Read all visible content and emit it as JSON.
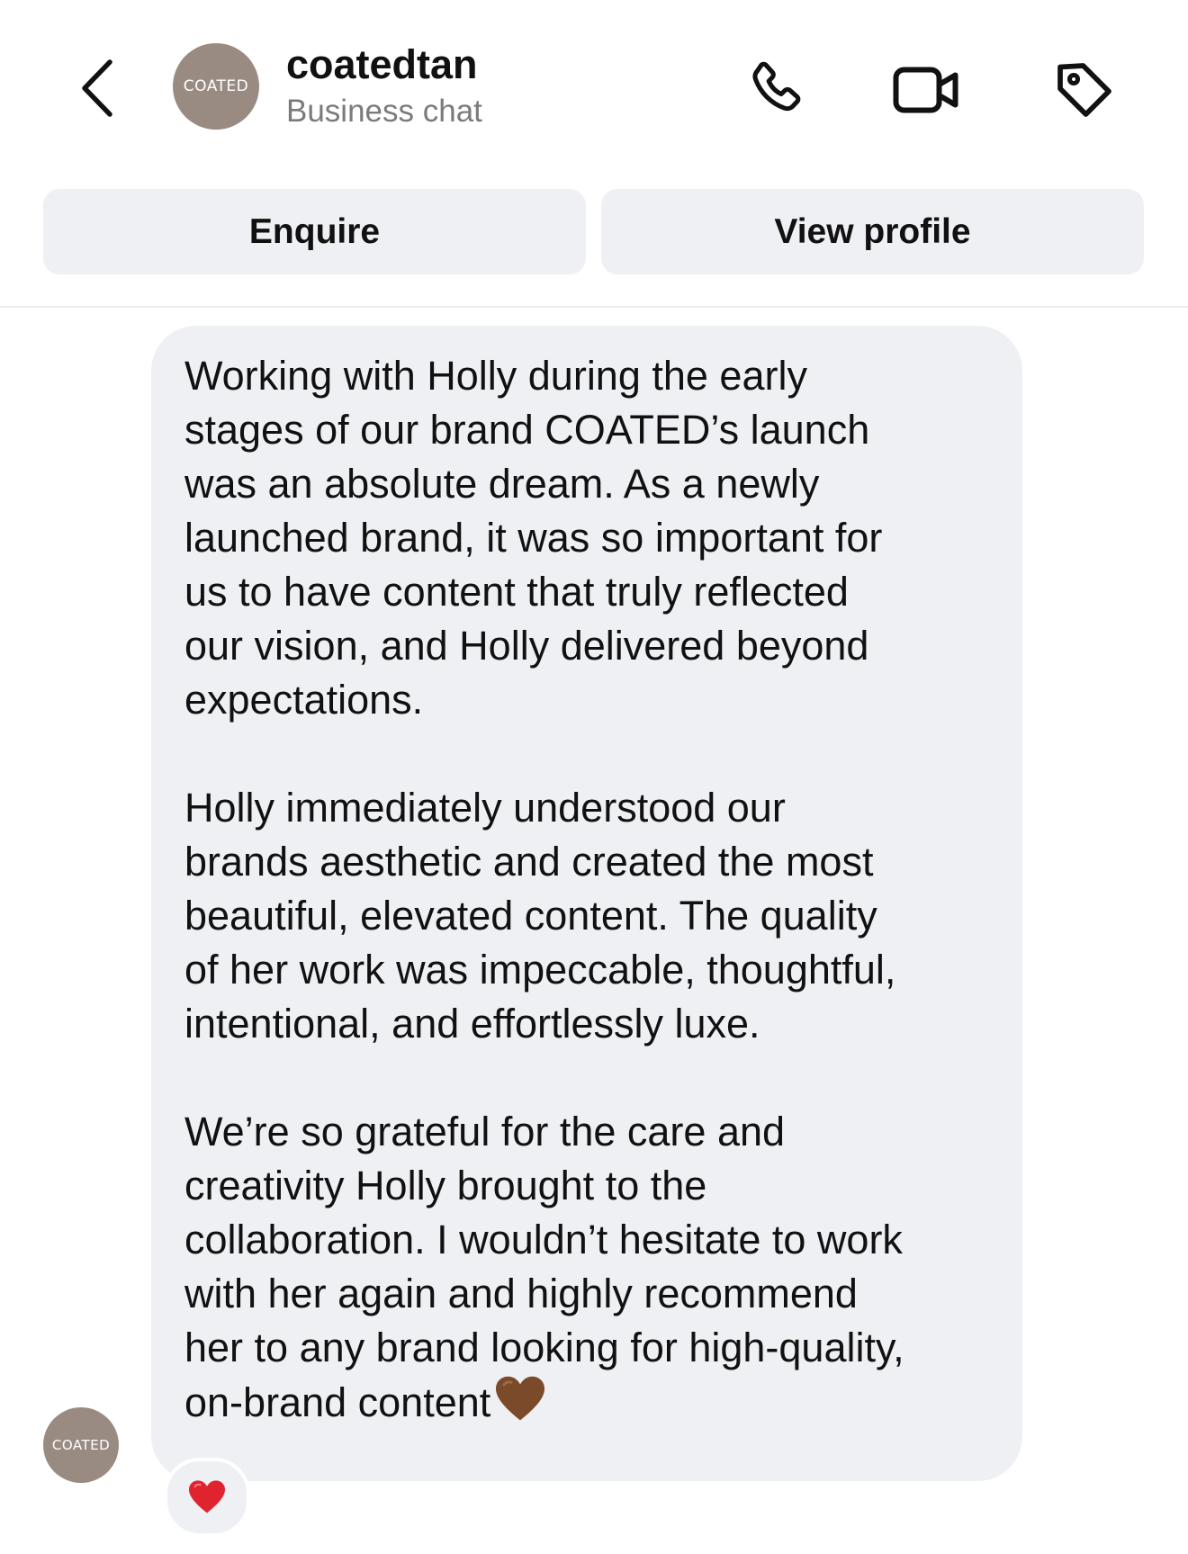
{
  "header": {
    "back_icon": "chevron-left-icon",
    "avatar_text": "COATED",
    "title": "coatedtan",
    "subtitle": "Business chat",
    "icons": [
      "phone-icon",
      "video-camera-icon",
      "tag-icon"
    ]
  },
  "actions": {
    "enquire_label": "Enquire",
    "view_profile_label": "View profile"
  },
  "message": {
    "paragraphs": [
      "Working with Holly during the early\nstages of our brand COATED’s launch\nwas an absolute dream. As a newly\nlaunched brand, it was so important for\nus to have content that truly reflected\nour vision, and Holly delivered beyond\nexpectations.",
      "Holly immediately understood our\nbrands aesthetic and created the most\nbeautiful, elevated content. The quality\nof her work was impeccable, thoughtful,\nintentional, and effortlessly luxe.",
      "We’re so grateful for the care and\ncreativity Holly brought to the\ncollaboration. I wouldn’t hesitate to work\nwith her again and highly recommend\nher to any brand looking for high-quality,\non-brand content"
    ],
    "trailing_emoji": "brown-heart-icon",
    "sender_avatar_text": "COATED",
    "reaction": "red-heart-icon"
  },
  "colors": {
    "avatar_bg": "#9a8b82",
    "button_bg": "#eff0f3",
    "bubble_bg": "#eff0f3",
    "subtitle": "#7b7b7b",
    "brown_heart": "#7a4a2a",
    "red_heart": "#e0242f"
  }
}
